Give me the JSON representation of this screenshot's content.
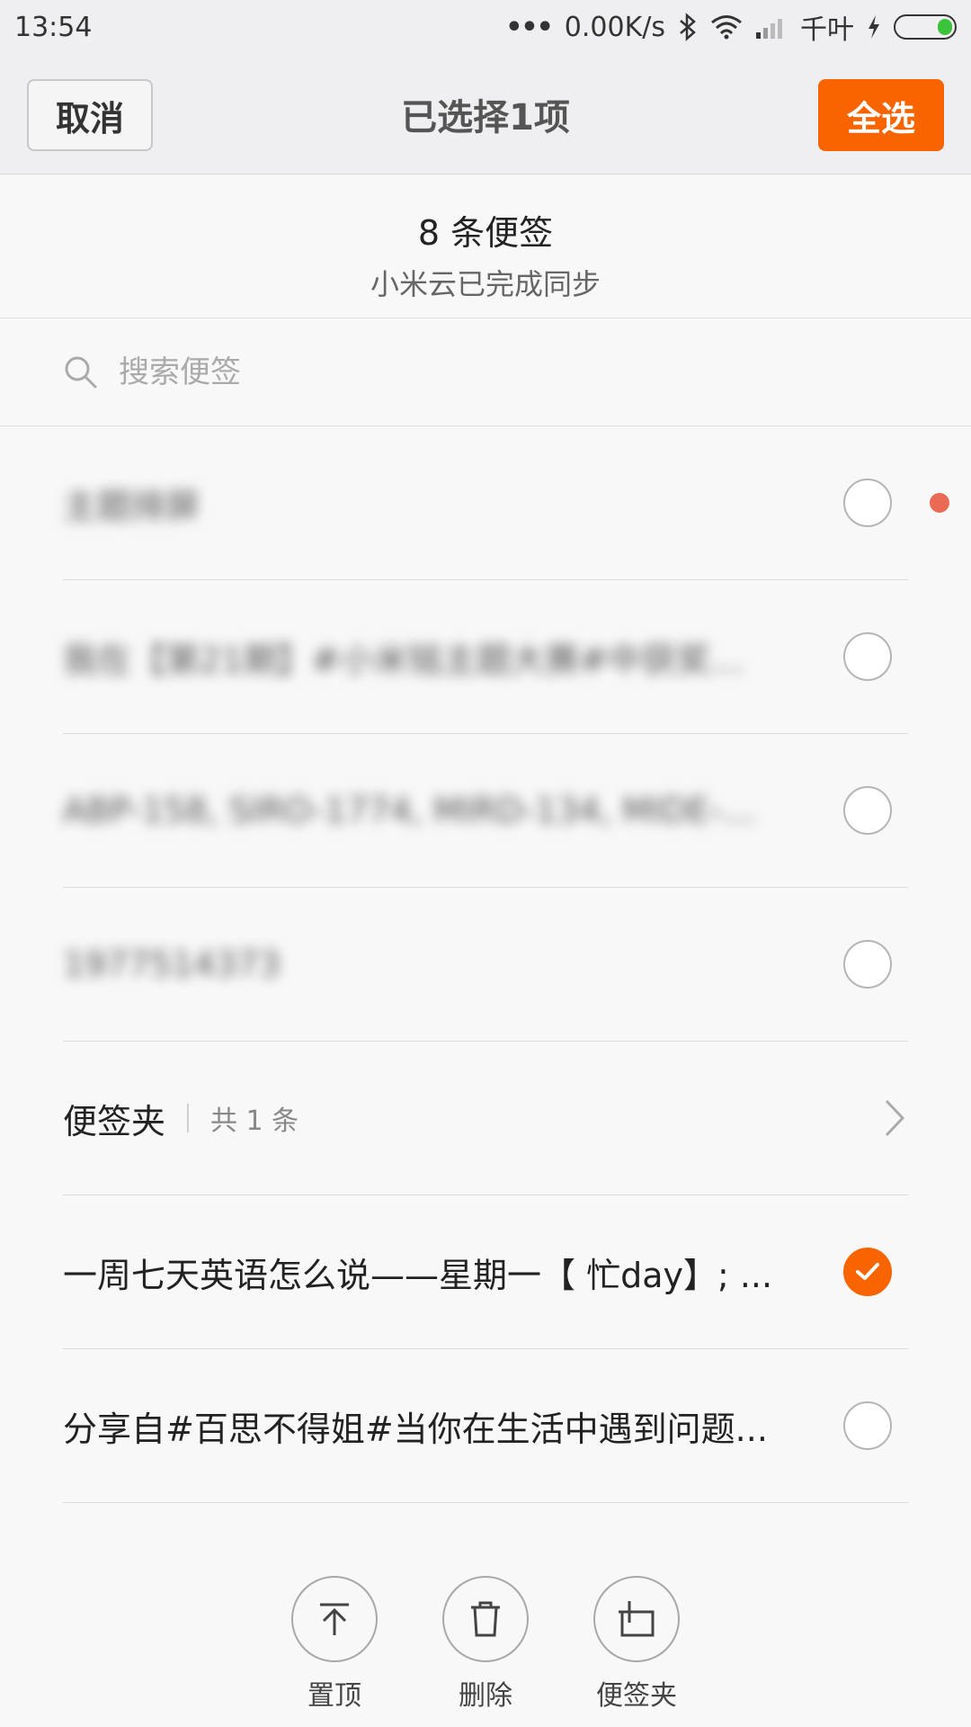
{
  "status_bar": {
    "time": "13:54",
    "dots": "•••",
    "speed": "0.00K/s",
    "carrier": "千叶"
  },
  "action_bar": {
    "cancel_label": "取消",
    "title": "已选择1项",
    "select_all_label": "全选"
  },
  "summary": {
    "count_text": "8 条便签",
    "sync_text": "小米云已完成同步"
  },
  "search": {
    "placeholder": "搜索便签"
  },
  "notes": [
    {
      "text": "主题排屏",
      "blurred": true,
      "checked": false
    },
    {
      "text": "我在【第21期】#小米铭主题大赛#中获奖了...",
      "blurred": true,
      "checked": false
    },
    {
      "text": "ABP-158, SIRO-1774, MIRD-134, MIDE-1...",
      "blurred": true,
      "checked": false
    },
    {
      "text": "1977514373",
      "blurred": true,
      "checked": false
    }
  ],
  "folder": {
    "name": "便签夹",
    "count": "共 1 条"
  },
  "folder_notes": [
    {
      "text": "一周七天英语怎么说——星期一【 忙day】; ...",
      "blurred": false,
      "checked": true
    },
    {
      "text": "分享自#百思不得姐#当你在生活中遇到问题...",
      "blurred": false,
      "checked": false
    }
  ],
  "toolbar": {
    "pin_label": "置顶",
    "delete_label": "删除",
    "move_label": "便签夹"
  },
  "colors": {
    "accent": "#f76400",
    "unread_dot": "#ea6a53",
    "battery": "#3cc33c"
  }
}
